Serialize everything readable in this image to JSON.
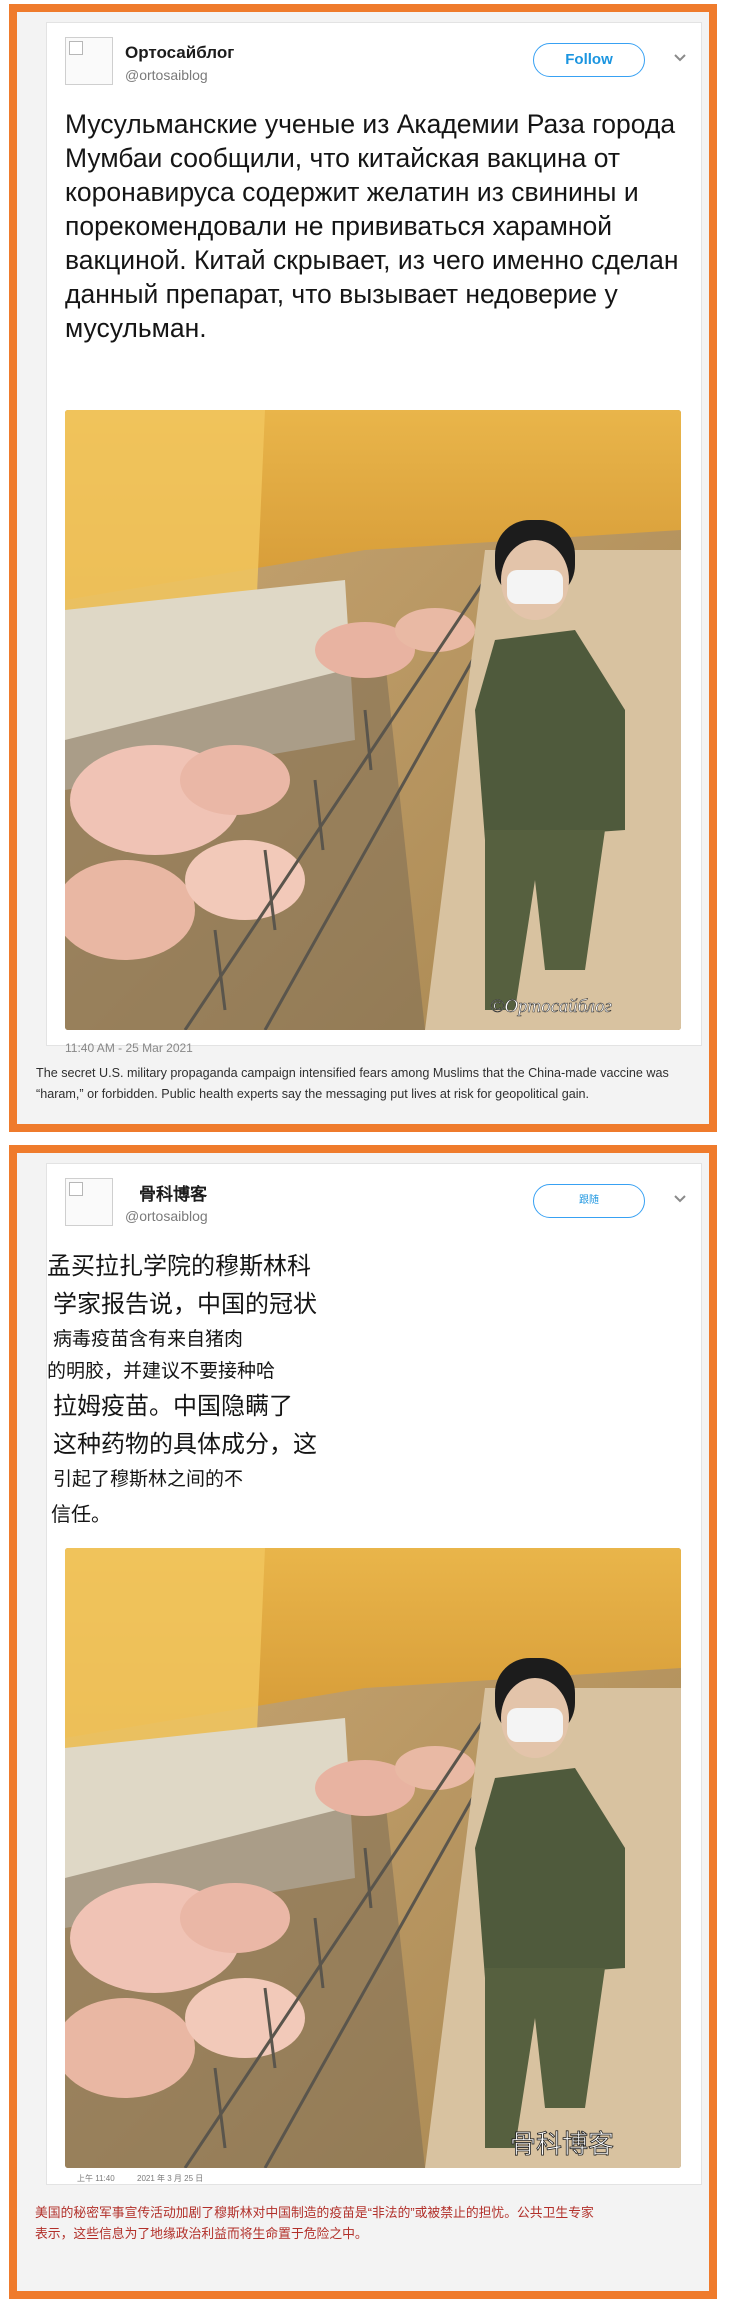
{
  "tweet_ru": {
    "display_name": "Ортосайблог",
    "handle": "@ortosaiblog",
    "follow_label": "Follow",
    "text": "Мусульманские ученые из Академии Раза города Мумбаи сообщили, что китайская вакцина от коронавируса содержит желатин из свинины и порекомендовали не прививаться харамной вакциной. Китай скрывает, из чего именно сделан данный препарат, что вызывает недоверие у мусульман.",
    "watermark": "©Ортосайблог",
    "timestamp": "11:40 AM - 25 Mar 2021"
  },
  "caption_en": "The secret U.S. military propaganda campaign intensified fears among Muslims that the China-made vaccine was “haram,” or forbidden. Public health experts say the messaging put lives at risk for geopolitical gain.",
  "tweet_zh": {
    "display_name": "骨科博客",
    "handle": "@ortosaiblog",
    "follow_label": "跟随",
    "text_lines": [
      "孟买拉扎学院的穆斯林科",
      "学家报告说，中国的冠状",
      "病毒疫苗含有来自猪肉",
      "的明胶，并建议不要接种哈",
      "拉姆疫苗。中国隐瞒了",
      "这种药物的具体成分，这",
      "引起了穆斯林之间的不",
      "信任。"
    ],
    "watermark": "骨科博客",
    "time": "上午 11:40",
    "date": "2021 年 3 月 25 日"
  },
  "caption_zh": "美国的秘密军事宣传活动加剧了穆斯林对中国制造的疫苗是“非法的”或被禁止的担忧。公共卫生专家表示，这些信息为了地缘政治利益而将生命置于危险之中。",
  "colors": {
    "frame": "#ef7b2c",
    "follow_blue": "#1b95e0",
    "caption_zh_red": "#b2302a"
  },
  "icons": [
    "avatar-placeholder-icon",
    "chevron-down-icon"
  ]
}
